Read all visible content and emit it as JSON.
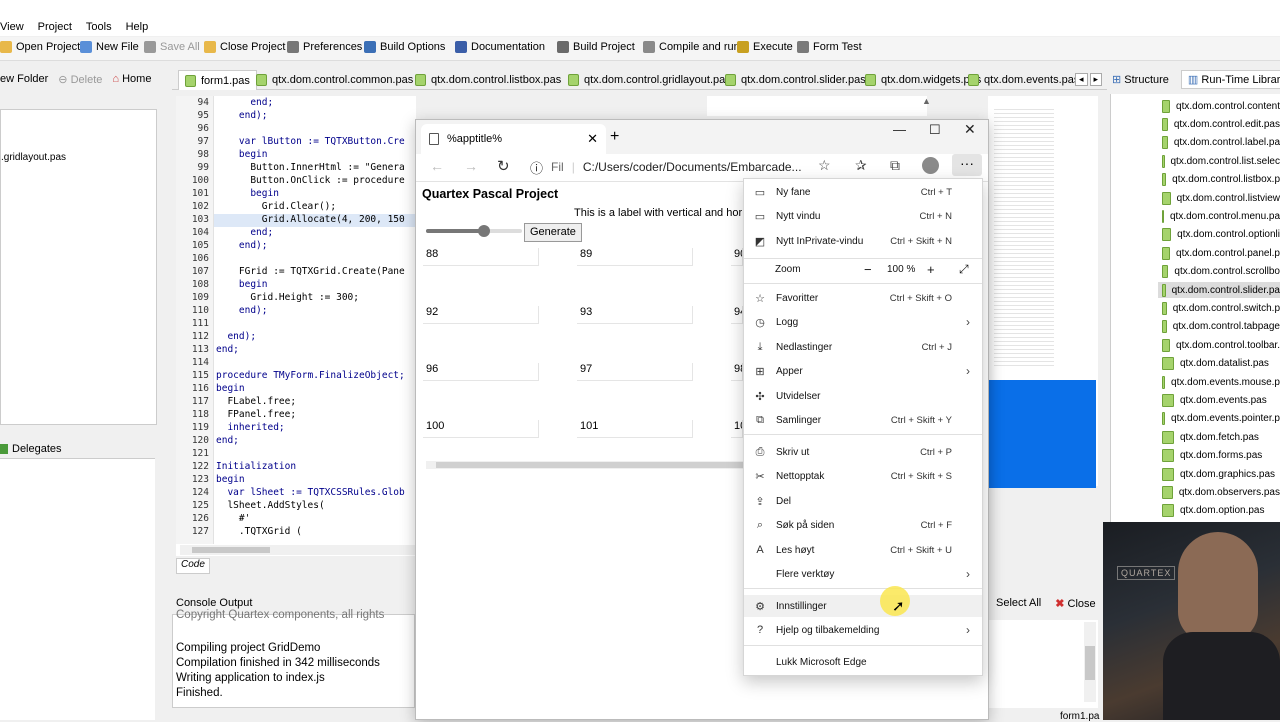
{
  "ide": {
    "menu": [
      "View",
      "Project",
      "Tools",
      "Help"
    ],
    "toolbar": [
      {
        "label": "Open Project",
        "icon": "folder-open-icon",
        "color": "#e8b84a"
      },
      {
        "label": "New File",
        "icon": "new-file-icon",
        "color": "#5a8fd8"
      },
      {
        "label": "Save All",
        "icon": "save-icon",
        "color": "#999999"
      },
      {
        "label": "Close Project",
        "icon": "folder-close-icon",
        "color": "#e8b84a"
      },
      {
        "label": "Preferences",
        "icon": "gear-icon",
        "color": "#777777"
      },
      {
        "label": "Build Options",
        "icon": "build-options-icon",
        "color": "#3b6fb6"
      },
      {
        "label": "Documentation",
        "icon": "book-icon",
        "color": "#3b5ea8"
      },
      {
        "label": "Build Project",
        "icon": "build-icon",
        "color": "#6a6a6a"
      },
      {
        "label": "Compile and run",
        "icon": "compile-icon",
        "color": "#8a8a8a"
      },
      {
        "label": "Execute",
        "icon": "execute-icon",
        "color": "#c8a020"
      },
      {
        "label": "Form Test",
        "icon": "form-test-icon",
        "color": "#7a7a7a"
      }
    ],
    "left_toolbar": {
      "new_folder": "ew Folder",
      "delete": "Delete",
      "home": "Home"
    },
    "left_item": ".gridlayout.pas",
    "delegates_tab": "Delegates",
    "tabs": [
      "form1.pas",
      "qtx.dom.control.common.pas",
      "qtx.dom.control.listbox.pas",
      "qtx.dom.control.gridlayout.pas",
      "qtx.dom.control.slider.pas",
      "qtx.dom.widgets.pas",
      "qtx.dom.events.pas"
    ],
    "right_tabs": {
      "structure": "Structure",
      "runtime": "Run-Time Library"
    },
    "code_tab": "Code",
    "console_title": "Console Output",
    "console_lines": [
      "Copyright Quartex components, all rights",
      "Compiling project GridDemo",
      "Compilation finished in 342 milliseconds",
      "Writing application to index.js",
      "Finished."
    ],
    "console_buttons": {
      "select_all": "Select All",
      "close": "Close"
    },
    "status_right": "form1.pa",
    "code_lines": [
      {
        "n": "94",
        "t": "      end;"
      },
      {
        "n": "95",
        "t": "    end);"
      },
      {
        "n": "96",
        "t": ""
      },
      {
        "n": "97",
        "t": "    var lButton := TQTXButton.Cre"
      },
      {
        "n": "98",
        "t": "    begin"
      },
      {
        "n": "99",
        "t": "      Button.InnerHtml := \"Genera"
      },
      {
        "n": "100",
        "t": "      Button.OnClick := procedure"
      },
      {
        "n": "101",
        "t": "      begin"
      },
      {
        "n": "102",
        "t": "        Grid.Clear();"
      },
      {
        "n": "103",
        "t": "        Grid.Allocate(4, 200, 150"
      },
      {
        "n": "104",
        "t": "      end;"
      },
      {
        "n": "105",
        "t": "    end);"
      },
      {
        "n": "106",
        "t": ""
      },
      {
        "n": "107",
        "t": "    FGrid := TQTXGrid.Create(Pane"
      },
      {
        "n": "108",
        "t": "    begin"
      },
      {
        "n": "109",
        "t": "      Grid.Height := 300;"
      },
      {
        "n": "110",
        "t": "    end);"
      },
      {
        "n": "111",
        "t": ""
      },
      {
        "n": "112",
        "t": "  end);"
      },
      {
        "n": "113",
        "t": "end;"
      },
      {
        "n": "114",
        "t": ""
      },
      {
        "n": "115",
        "t": "procedure TMyForm.FinalizeObject;"
      },
      {
        "n": "116",
        "t": "begin"
      },
      {
        "n": "117",
        "t": "  FLabel.free;"
      },
      {
        "n": "118",
        "t": "  FPanel.free;"
      },
      {
        "n": "119",
        "t": "  inherited;"
      },
      {
        "n": "120",
        "t": "end;"
      },
      {
        "n": "121",
        "t": ""
      },
      {
        "n": "122",
        "t": "Initialization"
      },
      {
        "n": "123",
        "t": "begin"
      },
      {
        "n": "124",
        "t": "  var lSheet := TQTXCSSRules.Glob"
      },
      {
        "n": "125",
        "t": "  lSheet.AddStyles("
      },
      {
        "n": "126",
        "t": "    #'"
      },
      {
        "n": "127",
        "t": "    .TQTXGrid ("
      }
    ],
    "runtime_files": [
      "qtx.dom.control.content",
      "qtx.dom.control.edit.pas",
      "qtx.dom.control.label.pa",
      "qtx.dom.control.list.selec",
      "qtx.dom.control.listbox.p",
      "qtx.dom.control.listview",
      "qtx.dom.control.menu.pa",
      "qtx.dom.control.optionli",
      "qtx.dom.control.panel.p",
      "qtx.dom.control.scrollbo",
      "qtx.dom.control.slider.pa",
      "qtx.dom.control.switch.p",
      "qtx.dom.control.tabpage",
      "qtx.dom.control.toolbar.",
      "qtx.dom.datalist.pas",
      "qtx.dom.events.mouse.p",
      "qtx.dom.events.pas",
      "qtx.dom.events.pointer.p",
      "qtx.dom.fetch.pas",
      "qtx.dom.forms.pas",
      "qtx.dom.graphics.pas",
      "qtx.dom.observers.pas",
      "qtx.dom.option.pas"
    ]
  },
  "browser": {
    "tab_title": "%apptitle%",
    "url_prefix": "Fil",
    "url": "C:/Users/coder/Documents/Embarcade...",
    "page_title": "Quartex Pascal Project",
    "label_text": "This is a label with vertical and hor",
    "generate_label": "Generate",
    "slider_value": 0.6,
    "grid": [
      [
        "88",
        "89",
        "90"
      ],
      [
        "92",
        "93",
        "94"
      ],
      [
        "96",
        "97",
        "98"
      ],
      [
        "100",
        "101",
        "10"
      ]
    ]
  },
  "menu": {
    "zoom_label": "Zoom",
    "zoom_value": "100 %",
    "items": [
      {
        "label": "Ny fane",
        "shortcut": "Ctrl + T",
        "icon": "new-tab-icon",
        "glyph": "▭"
      },
      {
        "label": "Nytt vindu",
        "shortcut": "Ctrl + N",
        "icon": "new-window-icon",
        "glyph": "▭"
      },
      {
        "label": "Nytt InPrivate-vindu",
        "shortcut": "Ctrl + Skift + N",
        "icon": "inprivate-icon",
        "glyph": "◩"
      },
      {
        "label": "Favoritter",
        "shortcut": "Ctrl + Skift + O",
        "icon": "favorites-icon",
        "glyph": "☆"
      },
      {
        "label": "Logg",
        "shortcut": "",
        "icon": "history-icon",
        "glyph": "◷",
        "arrow": true
      },
      {
        "label": "Nedlastinger",
        "shortcut": "Ctrl + J",
        "icon": "download-icon",
        "glyph": "⤓"
      },
      {
        "label": "Apper",
        "shortcut": "",
        "icon": "apps-icon",
        "glyph": "⊞",
        "arrow": true
      },
      {
        "label": "Utvidelser",
        "shortcut": "",
        "icon": "extensions-icon",
        "glyph": "✣"
      },
      {
        "label": "Samlinger",
        "shortcut": "Ctrl + Skift + Y",
        "icon": "collections-icon",
        "glyph": "⧉"
      },
      {
        "label": "Skriv ut",
        "shortcut": "Ctrl + P",
        "icon": "print-icon",
        "glyph": "⎙"
      },
      {
        "label": "Nettopptak",
        "shortcut": "Ctrl + Skift + S",
        "icon": "web-capture-icon",
        "glyph": "✂"
      },
      {
        "label": "Del",
        "shortcut": "",
        "icon": "share-icon",
        "glyph": "⇪"
      },
      {
        "label": "Søk på siden",
        "shortcut": "Ctrl + F",
        "icon": "find-icon",
        "glyph": "⌕"
      },
      {
        "label": "Les høyt",
        "shortcut": "Ctrl + Skift + U",
        "icon": "read-aloud-icon",
        "glyph": "A"
      },
      {
        "label": "Flere verktøy",
        "shortcut": "",
        "icon": "more-tools-icon",
        "glyph": "",
        "arrow": true
      },
      {
        "label": "Innstillinger",
        "shortcut": "",
        "icon": "settings-icon",
        "glyph": "⚙"
      },
      {
        "label": "Hjelp og tilbakemelding",
        "shortcut": "",
        "icon": "help-icon",
        "glyph": "?",
        "arrow": true
      },
      {
        "label": "Lukk Microsoft Edge",
        "shortcut": "",
        "icon": "",
        "glyph": ""
      }
    ]
  },
  "webcam_text": "QUARTEX"
}
